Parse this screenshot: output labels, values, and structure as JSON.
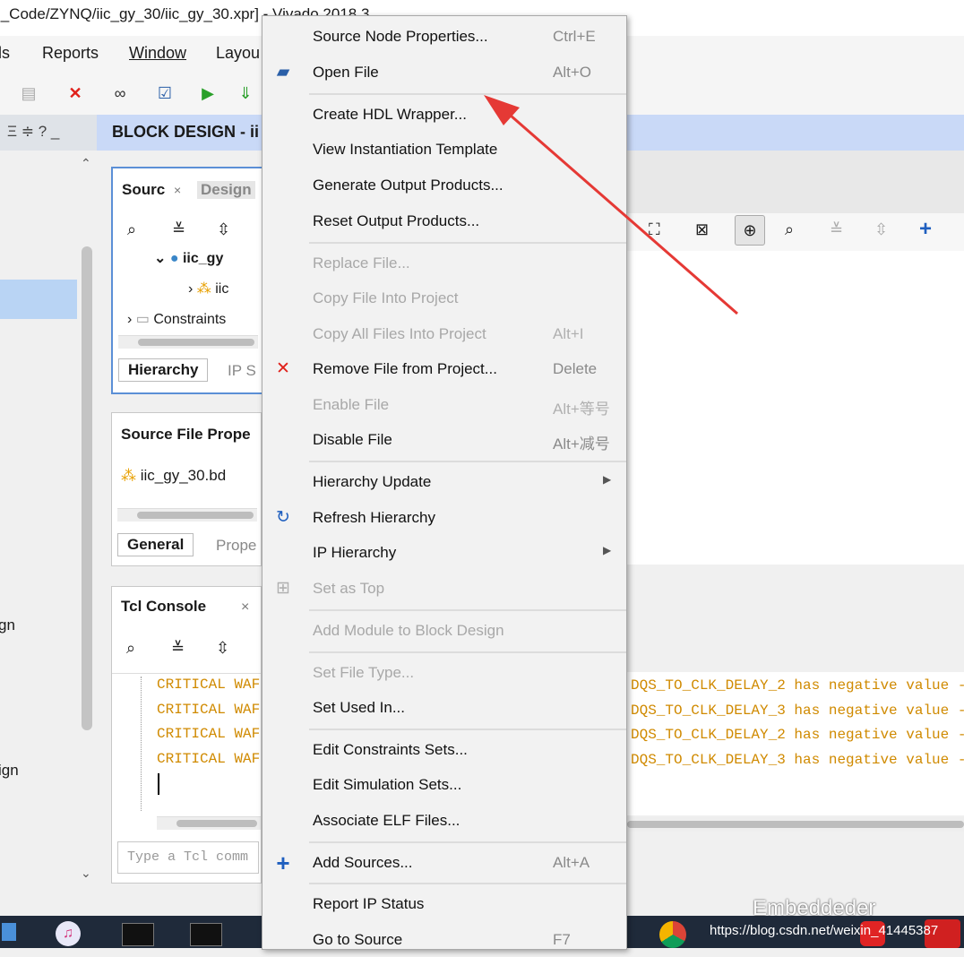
{
  "window": {
    "title": "]_Code/ZYNQ/iic_gy_30/iic_gy_30.xpr] - Vivado 2018.3"
  },
  "menubar": {
    "items": [
      "ls",
      "Reports",
      "Window",
      "Layou"
    ]
  },
  "left_panel": {
    "header_icons": [
      "Ξ ≑ ? _"
    ],
    "labels": [
      "gn",
      "ign"
    ]
  },
  "block_design": {
    "title": "BLOCK DESIGN - ii"
  },
  "sources": {
    "tabs": [
      "Sourc",
      "Design"
    ],
    "tree": [
      {
        "label": "iic_gy",
        "indent": 1
      },
      {
        "label": "iic",
        "indent": 2
      },
      {
        "label": "Constraints",
        "indent": 0
      }
    ],
    "bottom_tabs": [
      "Hierarchy",
      "IP S"
    ]
  },
  "source_file_props": {
    "title": "Source File Prope",
    "file": "iic_gy_30.bd",
    "tabs": [
      "General",
      "Prope"
    ]
  },
  "tcl_console": {
    "title": "Tcl Console",
    "lines": [
      "CRITICAL WAF",
      "CRITICAL WAF",
      "CRITICAL WAF",
      "CRITICAL WAF"
    ],
    "right_lines": [
      "DQS_TO_CLK_DELAY_2 has negative value -",
      "DQS_TO_CLK_DELAY_3 has negative value -",
      "DQS_TO_CLK_DELAY_2 has negative value -",
      "DQS_TO_CLK_DELAY_3 has negative value -"
    ],
    "input_placeholder": "Type a Tcl comm"
  },
  "context_menu": {
    "items": [
      {
        "label": "Source Node Properties...",
        "shortcut": "Ctrl+E",
        "enabled": true,
        "icon": ""
      },
      {
        "label": "Open File",
        "shortcut": "Alt+O",
        "enabled": true,
        "icon": "folder-icon"
      },
      {
        "label": "Create HDL Wrapper...",
        "shortcut": "",
        "enabled": true,
        "icon": ""
      },
      {
        "label": "View Instantiation Template",
        "shortcut": "",
        "enabled": true,
        "icon": ""
      },
      {
        "label": "Generate Output Products...",
        "shortcut": "",
        "enabled": true,
        "icon": ""
      },
      {
        "label": "Reset Output Products...",
        "shortcut": "",
        "enabled": true,
        "icon": ""
      },
      {
        "label": "Replace File...",
        "shortcut": "",
        "enabled": false,
        "icon": ""
      },
      {
        "label": "Copy File Into Project",
        "shortcut": "",
        "enabled": false,
        "icon": ""
      },
      {
        "label": "Copy All Files Into Project",
        "shortcut": "Alt+I",
        "enabled": false,
        "icon": ""
      },
      {
        "label": "Remove File from Project...",
        "shortcut": "Delete",
        "enabled": true,
        "icon": "remove-icon"
      },
      {
        "label": "Enable File",
        "shortcut": "Alt+等号",
        "enabled": false,
        "icon": ""
      },
      {
        "label": "Disable File",
        "shortcut": "Alt+减号",
        "enabled": true,
        "icon": ""
      },
      {
        "label": "Hierarchy Update",
        "shortcut": "",
        "enabled": true,
        "icon": "",
        "submenu": true
      },
      {
        "label": "Refresh Hierarchy",
        "shortcut": "",
        "enabled": true,
        "icon": "refresh-icon"
      },
      {
        "label": "IP Hierarchy",
        "shortcut": "",
        "enabled": true,
        "icon": "",
        "submenu": true
      },
      {
        "label": "Set as Top",
        "shortcut": "",
        "enabled": false,
        "icon": "hierarchy-icon"
      },
      {
        "label": "Add Module to Block Design",
        "shortcut": "",
        "enabled": false,
        "icon": ""
      },
      {
        "label": "Set File Type...",
        "shortcut": "",
        "enabled": false,
        "icon": ""
      },
      {
        "label": "Set Used In...",
        "shortcut": "",
        "enabled": true,
        "icon": ""
      },
      {
        "label": "Edit Constraints Sets...",
        "shortcut": "",
        "enabled": true,
        "icon": ""
      },
      {
        "label": "Edit Simulation Sets...",
        "shortcut": "",
        "enabled": true,
        "icon": ""
      },
      {
        "label": "Associate ELF Files...",
        "shortcut": "",
        "enabled": true,
        "icon": ""
      },
      {
        "label": "Add Sources...",
        "shortcut": "Alt+A",
        "enabled": true,
        "icon": "add-icon"
      },
      {
        "label": "Report IP Status",
        "shortcut": "",
        "enabled": true,
        "icon": ""
      },
      {
        "label": "Go to Source",
        "shortcut": "F7",
        "enabled": true,
        "icon": ""
      }
    ]
  },
  "watermark": {
    "text": "Embeddeder",
    "url": "https://blog.csdn.net/weixin_41445387"
  },
  "colors": {
    "accent": "#c9d9f7",
    "arrow": "#e53935",
    "critical": "#d08a00",
    "remove": "#e0201a",
    "add": "#1f5fbf"
  }
}
